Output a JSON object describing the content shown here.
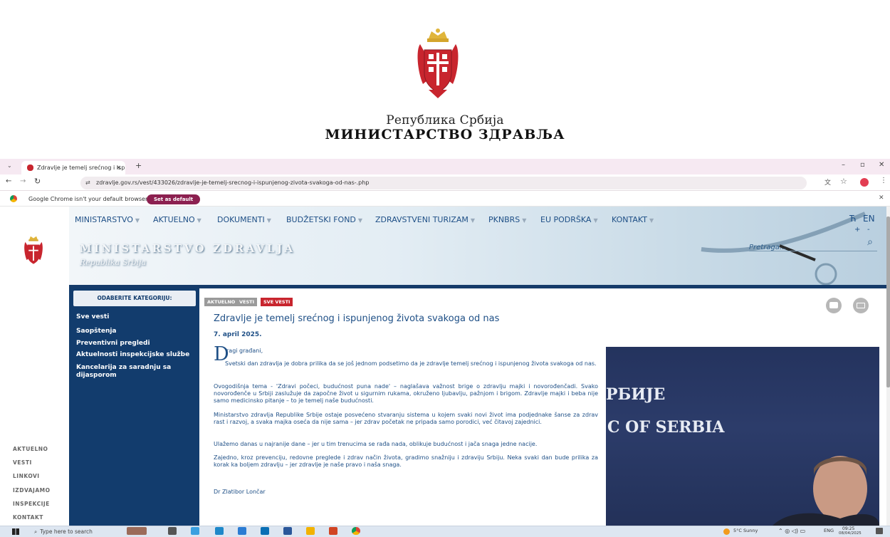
{
  "header": {
    "line1": "Република Србија",
    "line2": "МИНИСТАРСТВО ЗДРАВЉА"
  },
  "browser": {
    "tab_title": "Zdravlje je temelj srećnog i isp",
    "url": "zdravlje.gov.rs/vest/433026/zdravlje-je-temelj-srecnog-i-ispunjenog-zivota-svakoga-od-nas-.php",
    "notice": "Google Chrome isn't your default browser",
    "set_default": "Set as default",
    "colors": {
      "tabbar": "#f6e9f2",
      "setdefault": "#8c2050"
    }
  },
  "site": {
    "menu": [
      "MINISTARSTVO",
      "AKTUELNO",
      "DOKUMENTI",
      "BUDŽETSKI FOND",
      "ZDRAVSTVENI TURIZAM",
      "PKNBRS",
      "EU PODRŠKA",
      "KONTAKT"
    ],
    "lang_cyr": "Ћ",
    "lang_en": "EN",
    "font_plus": "+",
    "font_minus": "-",
    "title": "Ministarstvo zdravlja",
    "subtitle": "Republika Srbija",
    "search_placeholder": "Pretraga..."
  },
  "left_nav": [
    "AKTUELNO",
    "VESTI",
    "LINKOVI",
    "IZDVAJAMO",
    "INSPEKCIJE",
    "KONTAKT"
  ],
  "sidebar": {
    "heading": "ODABERITE KATEGORIJU:",
    "items": [
      "Sve vesti",
      "Saopštenja",
      "Preventivni pregledi",
      "Aktuelnosti inspekcijske službe",
      "Kancelarija za saradnju sa dijasporom"
    ]
  },
  "article": {
    "badges": [
      "AKTUELNO",
      "VESTI",
      "SVE VESTI"
    ],
    "title": "Zdravlje je temelj srećnog i ispunjenog života svakoga od nas",
    "date": "7. april 2025.",
    "dropcap": "D",
    "greeting": "ragi građani,",
    "p1": "Svetski dan zdravlja je dobra prilika da se još jednom podsetimo da je zdravlje temelj srećnog i ispunjenog života svakoga od nas.",
    "p2": "Ovogodišnja tema - 'Zdravi počeci, budućnost puna nade' – naglašava važnost brige o zdravlju majki i novorođenčadi. Svako novorođenče u Srbiji zaslužuje da započne život u sigurnim rukama, okruženo ljubavlju, pažnjom i brigom. Zdravlje majki i beba nije samo medicinsko pitanje – to je temelj naše budućnosti.",
    "p3": "Ministarstvo zdravlja Republike Srbije ostaje posvećeno stvaranju sistema u kojem svaki novi život ima podjednake šanse za zdrav rast i razvoj, a svaka majka oseća da nije sama – jer zdrav početak ne pripada samo porodici, već čitavoj zajednici.",
    "p4": "Ulažemo danas u najranije dane – jer u tim trenucima se rađa nada, oblikuje budućnost i jača snaga jedne nacije.",
    "p5": "Zajedno, kroz prevenciju, redovne preglede i zdrav način života, gradimo snažniju i zdraviju Srbiju. Neka svaki dan bude prilika za korak ka boljem zdravlju – jer zdravlje je naše pravo i naša snaga.",
    "signature": "Dr Zlatibor Lončar",
    "photo_text1": "РБИЈЕ",
    "photo_text2": "C OF SERBIA"
  },
  "taskbar": {
    "search": "Type here to search",
    "weather": "5°C  Sunny",
    "lang": "ENG",
    "time": "09:25",
    "date": "08/04/2025"
  }
}
